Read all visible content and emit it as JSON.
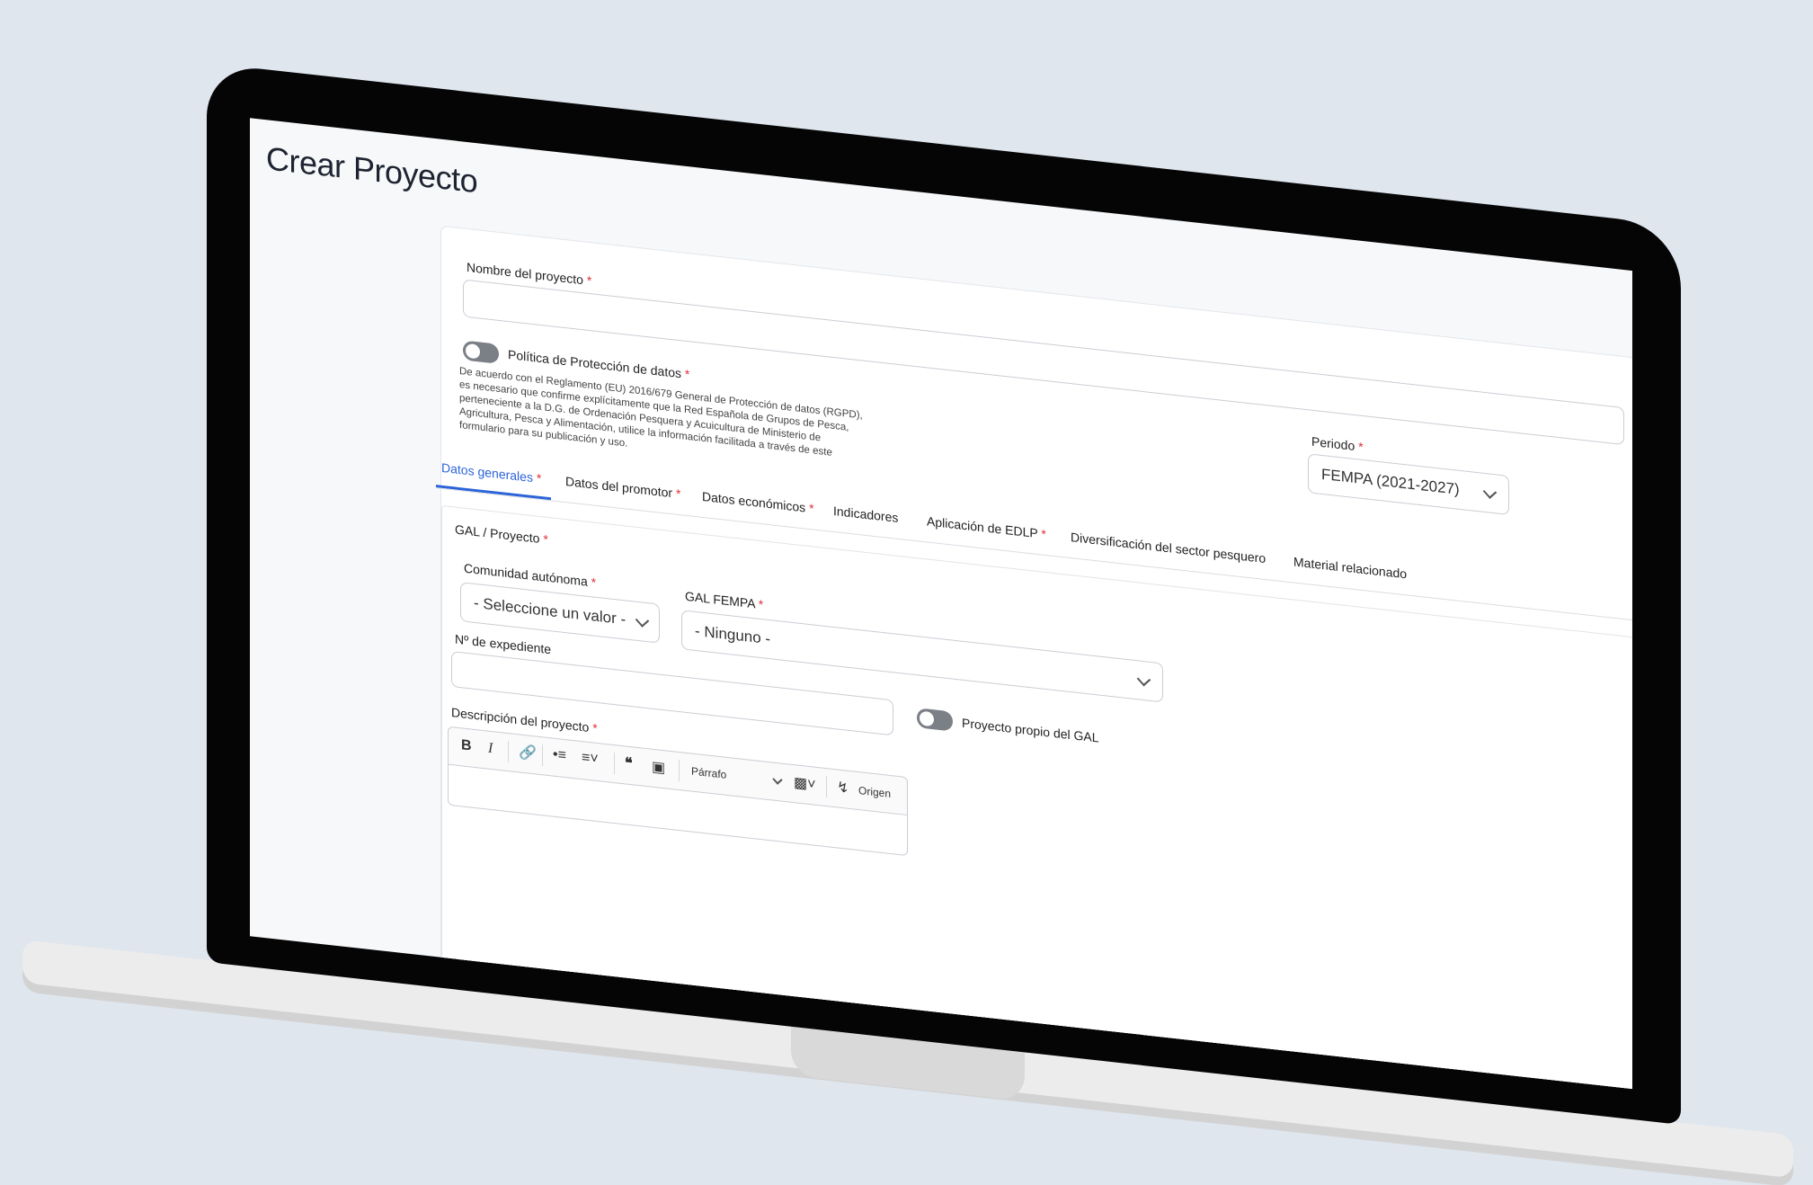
{
  "page": {
    "title": "Crear Proyecto"
  },
  "form": {
    "project_name_label": "Nombre del proyecto",
    "required_mark": "*",
    "project_name_value": "",
    "privacy_label": "Política de Protección de datos",
    "privacy_text": [
      "De acuerdo con el Reglamento (EU) 2016/679 General de Protección de datos (RGPD),",
      "es necesario que confirme explícitamente que la Red Española de Grupos de Pesca,",
      "perteneciente a la D.G. de Ordenación Pesquera y Acuicultura de Ministerio de",
      "Agricultura, Pesca y Alimentación, utilice la información facilitada a través de este",
      "formulario para su publicación y uso."
    ],
    "period_label": "Periodo",
    "period_value": "FEMPA (2021-2027)"
  },
  "tabs": [
    {
      "label": "Datos generales",
      "required": true,
      "active": true
    },
    {
      "label": "Datos del promotor",
      "required": true
    },
    {
      "label": "Datos económicos",
      "required": true
    },
    {
      "label": "Indicadores",
      "required": false
    },
    {
      "label": "Aplicación de EDLP",
      "required": true
    },
    {
      "label": "Diversificación del sector pesquero",
      "required": false
    },
    {
      "label": "Material relacionado",
      "required": false
    }
  ],
  "panel": {
    "section_label": "GAL / Proyecto",
    "ccaa_label": "Comunidad autónoma",
    "ccaa_value": "- Seleccione un valor -",
    "gal_label": "GAL FEMPA",
    "gal_value": "- Ninguno -",
    "expediente_label": "Nº de expediente",
    "expediente_value": "",
    "own_project_label": "Proyecto propio del GAL",
    "description_label": "Descripción del proyecto",
    "editor": {
      "bold": "B",
      "italic": "I",
      "paragraph": "Párrafo",
      "source": "Origen"
    }
  },
  "colors": {
    "accent": "#2b63d9",
    "required": "#e0313b",
    "toggle_off": "#7b7f86"
  }
}
